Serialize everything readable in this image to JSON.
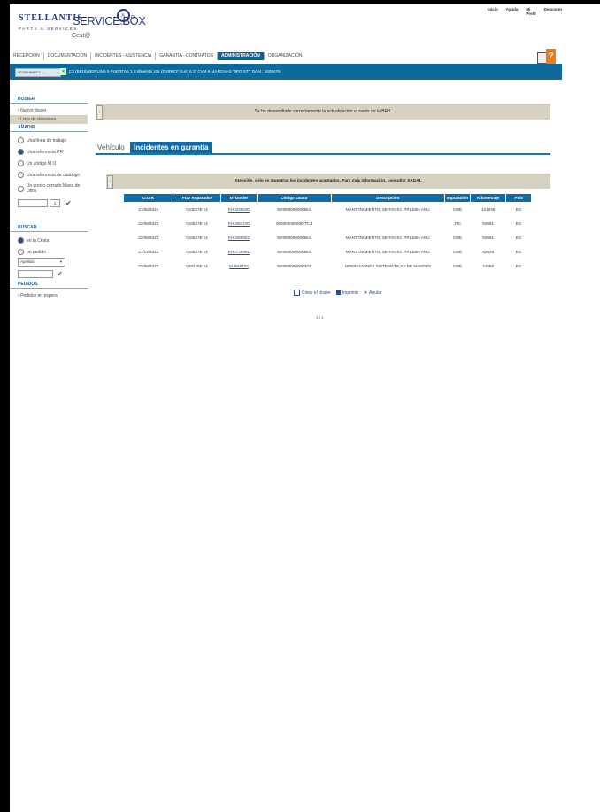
{
  "header": {
    "brand": "STELLANTIS",
    "brand_sub": "PARTS & SERVICES",
    "service_box": "SERVICE BOX",
    "service_box_sub": "Cest@",
    "badge_label": "citroën",
    "counter": "0",
    "top_links": [
      "Inicio",
      "Ayuda",
      "Mi Perfil",
      "Desconexión"
    ]
  },
  "nav": {
    "tabs": [
      "RECEPCIÓN",
      "DOCUMENTACIÓN",
      "INCIDENTES - ASISTENCIA",
      "GARANTÍA - CONTRATOS",
      "ADMINISTRACIÓN",
      "ORGANIZACIÓN"
    ],
    "active_index": 4
  },
  "vehicle": {
    "vin": "VF7SXHMZ6EU......",
    "description": "C3 (B618) BERLINA 5 PUERTAS 1.5 BlueHDi 101 (DV5RCF Euro 6.3) CVM 6 MARCHAS TIPO STT  DAM : 1609476"
  },
  "sidebar": {
    "dosier_heading": "DOSIER",
    "dosier_items": [
      "Nuevo dosier",
      "Lista de dossieres"
    ],
    "anadir_heading": "AÑADIR",
    "anadir_options": [
      "Una línea de trabajo",
      "Una referencia PR",
      "Un código M.O",
      "Una referencia de catálogo",
      "Un precio cerrado Mano de Obra"
    ],
    "anadir_selected": 1,
    "qty_value": "1",
    "buscar_heading": "BUSCAR",
    "buscar_options": [
      "en la Cesta",
      "un pedido"
    ],
    "buscar_selected": 0,
    "buscar_select": "Apellido",
    "pedidos_heading": "PEDIDOS",
    "pedidos_item": "Pedidos en espera"
  },
  "main": {
    "message": "Se ha desarrollado correctamente la actualización a través de la BRIL",
    "tabs": [
      "Vehículo",
      "Incidentes en garantía"
    ],
    "active_tab": 1,
    "warning": "Atención, sólo se muestran los incidentes aceptados. Para más información, consultar SAGAL",
    "columns": [
      "D.O.R",
      "PDV Reparador",
      "Nº Dosier",
      "Código causa",
      "Descripción",
      "Imputación",
      "Kilometraje",
      "País"
    ],
    "rows": [
      [
        "21/06/2024",
        "010027E 01",
        "EHJ338530",
        "000000000000561",
        "MANTENIMIENTO, SERVICIO, PRUEBA ANU",
        "CME",
        "121046",
        "ES"
      ],
      [
        "22/06/2023",
        "010627E 01",
        "EHJ493100",
        "000000000000/TCJ",
        "",
        "JTC",
        "92681",
        "ES"
      ],
      [
        "22/06/2023",
        "010627E 01",
        "EHJ495952",
        "000000000000561",
        "MANTENIMIENTO, SERVICIO, PRUEBA ANU",
        "CME",
        "92681",
        "ES"
      ],
      [
        "27/12/2022",
        "010627E 01",
        "EH3729481",
        "000000000000561",
        "MANTENIMIENTO, SERVICIO, PRUEBA ANU",
        "CME",
        "62029",
        "ES"
      ],
      [
        "02/06/2022",
        "026226E 01",
        "EH598402",
        "000000000000303",
        "OPERACIONES SISTEMÁTICAS DE MANTEN",
        "CME",
        "31658",
        "ES"
      ]
    ],
    "actions": [
      "Crear el dosier",
      "Imprimir",
      "Anular"
    ],
    "pager": "1 / 1"
  },
  "colors": {
    "primary_blue": "#0f6aa6",
    "brand_navy": "#243882",
    "panel_beige": "#d6d2c2",
    "help_orange": "#f07a18"
  }
}
